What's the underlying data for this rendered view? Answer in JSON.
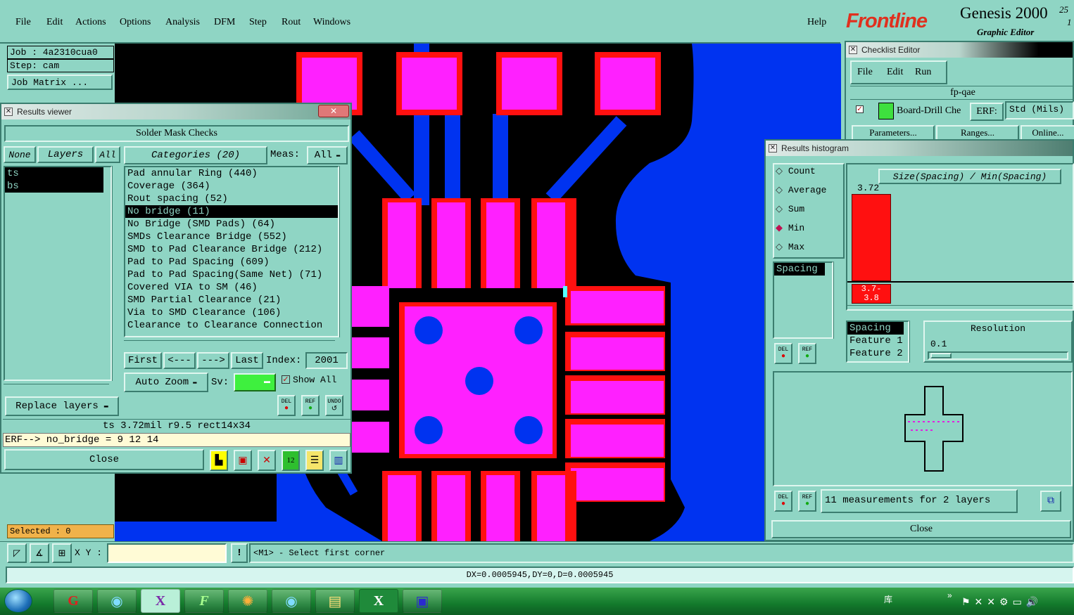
{
  "menubar": {
    "items": [
      "File",
      "Edit",
      "Actions",
      "Options",
      "Analysis",
      "DFM",
      "Step",
      "Rout",
      "Windows"
    ],
    "help": "Help"
  },
  "logo": {
    "brand": "Frontline",
    "product": "Genesis 2000",
    "sub": "Graphic Editor",
    "version_top": "25",
    "version_bot": "1"
  },
  "job": {
    "job_line": "Job : 4a2310cua0",
    "step_line": "Step: cam",
    "matrix_btn": "Job Matrix ...",
    "selected": "Selected : 0"
  },
  "results_viewer": {
    "title": "Results viewer",
    "header": "Solder Mask Checks",
    "btn_none": "None",
    "btn_layers": "Layers",
    "btn_all": "All",
    "layers": [
      "ts",
      "bs"
    ],
    "categories_label": "Categories (20)",
    "meas_label": "Meas:",
    "meas_value": "All",
    "categories": [
      "Pad annular Ring (440)",
      "Coverage (364)",
      "Rout spacing (52)",
      "No bridge (11)",
      "No Bridge (SMD Pads) (64)",
      "SMDs Clearance Bridge (552)",
      "SMD to Pad Clearance Bridge (212)",
      "Pad to Pad Spacing (609)",
      "Pad to Pad Spacing(Same Net) (71)",
      "Covered VIA to SM (46)",
      "SMD Partial Clearance (21)",
      "Via to SMD Clearance (106)",
      "Clearance to Clearance Connection"
    ],
    "selected_category": 3,
    "nav_first": "First",
    "nav_prev": "<---",
    "nav_next": "--->",
    "nav_last": "Last",
    "index_label": "Index:",
    "index_value": "2001",
    "replace_layers": "Replace layers",
    "auto_zoom": "Auto Zoom",
    "sv_label": "Sv:",
    "show_all": "Show All",
    "del": "DEL",
    "ref": "REF",
    "undo": "UNDO",
    "measure_line": "ts 3.72mil   r9.5   rect14x34",
    "erf_line": "ERF--> no_bridge = 9 12 14",
    "close": "Close"
  },
  "checklist_editor": {
    "title": "Checklist Editor",
    "menu": [
      "File",
      "Edit",
      "Run"
    ],
    "name": "fp-qae",
    "item": "Board-Drill Che",
    "erf_label": "ERF:",
    "erf_value": "Std (Mils)",
    "tabs": [
      "Parameters...",
      "Ranges...",
      "Online..."
    ]
  },
  "histogram": {
    "title": "Results histogram",
    "modes": [
      "Count",
      "Average",
      "Sum",
      "Min",
      "Max"
    ],
    "selected_mode": 3,
    "param_list": [
      "Spacing"
    ],
    "chart_title": "Size(Spacing) / Min(Spacing)",
    "bar_value_label": "3.72",
    "bar_value": 3.72,
    "bin_label": "3.7- 3.8",
    "features": [
      "Spacing",
      "Feature 1",
      "Feature 2"
    ],
    "resolution_label": "Resolution",
    "resolution_value": "0.1",
    "summary": "11 measurements for 2 layers",
    "close": "Close",
    "del": "DEL",
    "ref": "REF"
  },
  "cmdline": {
    "xy_label": "X Y :",
    "xy_value": "",
    "message": "<M1> - Select first corner"
  },
  "dxbar": "DX=0.0005945,DY=0,D=0.0005945",
  "taskbar": {
    "tray_text": "库",
    "tasks": [
      "genesis-icon",
      "eye-icon",
      "x-tool-icon",
      "f-icon",
      "shell-icon",
      "eye2-icon",
      "folder-icon",
      "excel-icon",
      "save-icon"
    ]
  },
  "colors": {
    "panel": "#8fd5c4",
    "pad": "#ff20ff",
    "clearance": "#ff1010",
    "copper": "#0033f0",
    "mask": "#000000"
  }
}
